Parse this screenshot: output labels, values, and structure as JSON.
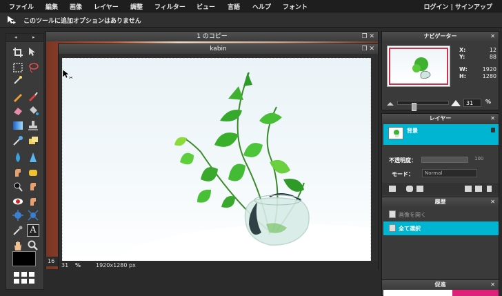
{
  "menubar": {
    "items": [
      "ファイル",
      "編集",
      "画像",
      "レイヤー",
      "調整",
      "フィルター",
      "ビュー",
      "言語",
      "ヘルプ",
      "フォント"
    ],
    "account": "ログイン | サインアップ"
  },
  "options_bar": {
    "message": "このツールに追加オプションはありません"
  },
  "toolbox": {
    "nav_left": "◂",
    "nav_right": "▸",
    "text_tool_glyph": "A"
  },
  "documents": {
    "back": {
      "title": "1 のコピー",
      "zoom": "16"
    },
    "front": {
      "title": "kabin",
      "zoom": "31",
      "zoom_unit": "%",
      "dimensions": "1920x1280 px"
    }
  },
  "navigator": {
    "title": "ナビゲーター",
    "x_label": "X:",
    "x_value": "12",
    "y_label": "Y:",
    "y_value": "88",
    "w_label": "W:",
    "w_value": "1920",
    "h_label": "H:",
    "h_value": "1280",
    "zoom_value": "31",
    "zoom_unit": "%",
    "zoom_level": 0.31
  },
  "layers": {
    "title": "レイヤー",
    "items": [
      {
        "name": "背景",
        "locked": true
      }
    ],
    "opacity_label": "不透明度：",
    "opacity_value": "100",
    "mode_label": "モード：",
    "mode_value": "Normal"
  },
  "history": {
    "title": "履歴",
    "items": [
      "画像を開く",
      "全て選択"
    ],
    "selected_index": 1
  },
  "promo": {
    "title": "促進"
  },
  "colors": {
    "accent": "#00b5d1",
    "nav_frame": "#d0304a"
  },
  "icons": [
    "crop-icon",
    "move-icon",
    "marquee-icon",
    "lasso-icon",
    "wand-icon",
    "pencil-icon",
    "brush-icon",
    "eraser-icon",
    "bucket-icon",
    "gradient-icon",
    "stamp-icon",
    "picker-icon",
    "patch-icon",
    "blur-icon",
    "sharpen-icon",
    "smudge-icon",
    "sponge-icon",
    "dodge-icon",
    "burn-icon",
    "redeye-icon",
    "spot-heal-icon",
    "bloat-icon",
    "pinch-icon",
    "color-picker-icon",
    "type-icon",
    "hand-icon",
    "zoom-icon"
  ]
}
